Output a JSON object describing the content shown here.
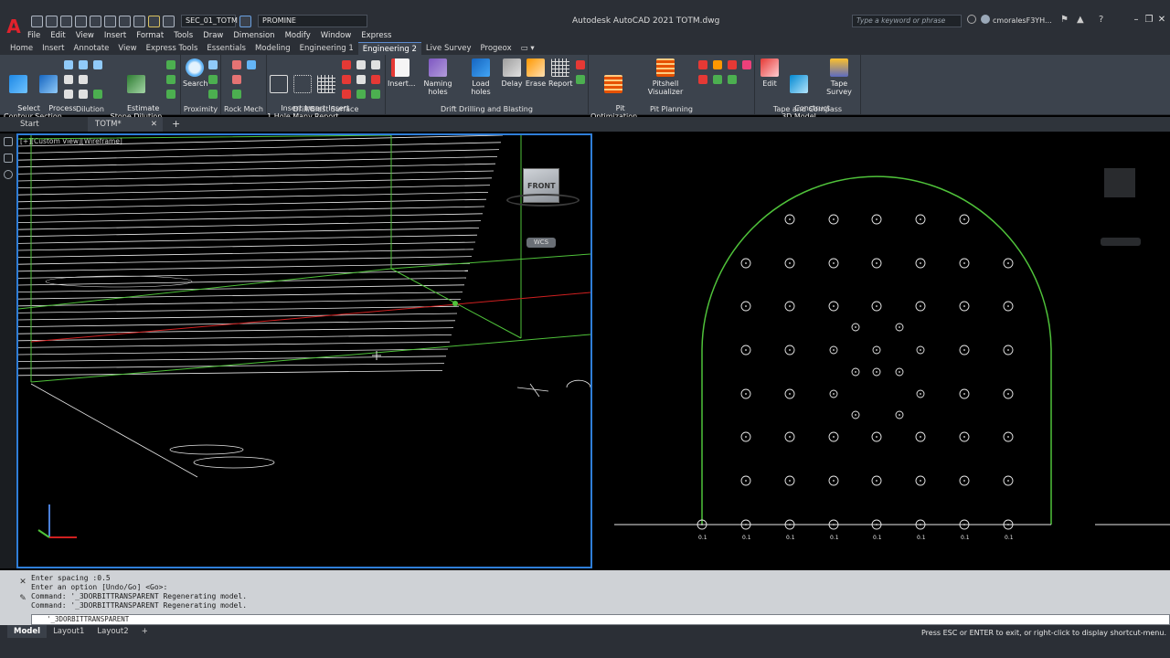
{
  "app": {
    "title": "Autodesk AutoCAD 2021    TOTM.dwg",
    "search_placeholder": "Type a keyword or phrase",
    "user": "cmoralesF3YH...",
    "workspace_combo": "SEC_01_TOTM",
    "profile_combo": "PROMINE"
  },
  "menu": [
    "File",
    "Edit",
    "View",
    "Insert",
    "Format",
    "Tools",
    "Draw",
    "Dimension",
    "Modify",
    "Window",
    "Express"
  ],
  "ribbon_tabs": [
    "Home",
    "Insert",
    "Annotate",
    "View",
    "Express Tools",
    "Essentials",
    "Modeling",
    "Engineering 1",
    "Engineering 2",
    "Live Survey",
    "Progeox"
  ],
  "active_ribbon_tab": "Engineering 2",
  "ribbon": {
    "groups": [
      {
        "title": "Dilution",
        "buttons": [
          "Select\nContour",
          "Process\nSection",
          "Estimate\nStope Dilution"
        ]
      },
      {
        "title": "Proximity",
        "buttons": [
          "Search"
        ]
      },
      {
        "title": "Rock Mech",
        "buttons": []
      },
      {
        "title": "Drill/Blast Surface",
        "buttons": [
          "Insert\n1 Hole",
          "Insert\nMany",
          "Insert\nReport"
        ]
      },
      {
        "title": "Drift Drilling and Blasting",
        "buttons": [
          "Insert...",
          "Naming holes",
          "Load holes",
          "Delay",
          "Erase",
          "Report"
        ]
      },
      {
        "title": "Pit Planning",
        "buttons": [
          "Pit\nOptimization",
          "Pitshell Visualizer"
        ]
      },
      {
        "title": "Tape and Compass",
        "buttons": [
          "Edit",
          "Construct\n3D Model",
          "Tape Survey"
        ]
      }
    ]
  },
  "doc_tabs": [
    "Start",
    "TOTM*"
  ],
  "viewport_left": {
    "label": "[+][Custom View][Wireframe]",
    "viewcube_face": "FRONT",
    "wcs": "WCS"
  },
  "viewport_right": {
    "hole_label_bottom": "0.1"
  },
  "command": {
    "history": [
      "Enter spacing :0.5",
      "Enter an option [Undo/Go] <Go>:",
      "Command: '_3DORBITTRANSPARENT Regenerating model.",
      "Command: '_3DORBITTRANSPARENT Regenerating model."
    ],
    "input": "'_3DORBITTRANSPARENT"
  },
  "layout_tabs": [
    "Model",
    "Layout1",
    "Layout2"
  ],
  "active_layout": "Model",
  "status_message": "Press ESC or ENTER to exit, or right-click to display shortcut-menu.",
  "colors": {
    "titlebar": "#2b2f36",
    "ribbon": "#3c434d",
    "viewport_border": "#2f7ed8",
    "contour_green": "#4fc23a",
    "axis_red": "#d02020"
  }
}
